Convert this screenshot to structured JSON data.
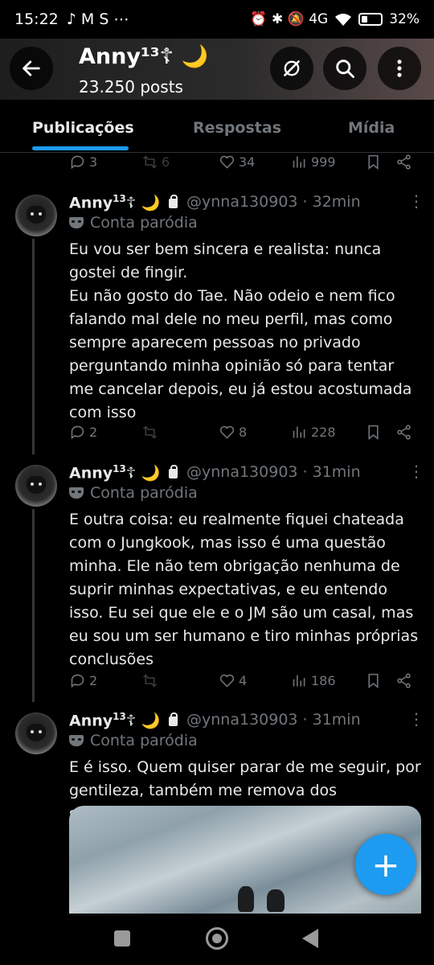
{
  "status_bar": {
    "time": "15:22",
    "notification_icons": "♪ M S ⋯",
    "system_icons": "⏰ ✱ 🔕 4G",
    "battery": "32%"
  },
  "header": {
    "title": "Anny¹³☦ 🌙",
    "posts_count": "23.250 posts",
    "back_icon": "arrow-left-icon",
    "actions": [
      "grok-icon",
      "search-icon",
      "more-vertical-icon"
    ]
  },
  "tabs": [
    {
      "label": "Publicações",
      "active": true
    },
    {
      "label": "Respostas",
      "active": false
    },
    {
      "label": "Mídia",
      "active": false
    }
  ],
  "top_actions": {
    "replies": "3",
    "reposts": "6",
    "likes": "34",
    "views": "999"
  },
  "posts": [
    {
      "name": "Anny",
      "name_sup": "13",
      "name_suffix": "☦ 🌙",
      "handle": "@ynna130903 · 32min",
      "badge": "Conta paródia",
      "text": "Eu vou ser bem sincera e realista: nunca gostei de fingir.\nEu não gosto do Tae. Não odeio e nem fico falando mal dele no meu perfil, mas como sempre aparecem pessoas no privado perguntando minha opinião só para tentar me cancelar depois, eu já estou acostumada com isso",
      "replies": "2",
      "reposts": "",
      "likes": "8",
      "views": "228"
    },
    {
      "name": "Anny",
      "name_sup": "13",
      "name_suffix": "☦ 🌙",
      "handle": "@ynna130903 · 31min",
      "badge": "Conta paródia",
      "text": "E outra coisa: eu realmente fiquei chateada com o Jungkook, mas isso é uma questão minha. Ele não tem obrigação nenhuma de suprir minhas expectativas, e eu entendo isso. Eu sei que ele e o JM são um casal, mas eu sou um ser humano e tiro minhas próprias conclusões",
      "replies": "2",
      "reposts": "",
      "likes": "4",
      "views": "186"
    },
    {
      "name": "Anny",
      "name_sup": "13",
      "name_suffix": "☦ 🌙",
      "handle": "@ynna130903 · 31min",
      "badge": "Conta paródia",
      "text": "E é isso. Quem quiser parar de me seguir, por gentileza, também me remova dos seguidores"
    }
  ],
  "fab": {
    "label": "+"
  },
  "colors": {
    "accent": "#1d9bf0",
    "muted": "#71767b",
    "text": "#e7e9ea",
    "background": "#000000"
  }
}
